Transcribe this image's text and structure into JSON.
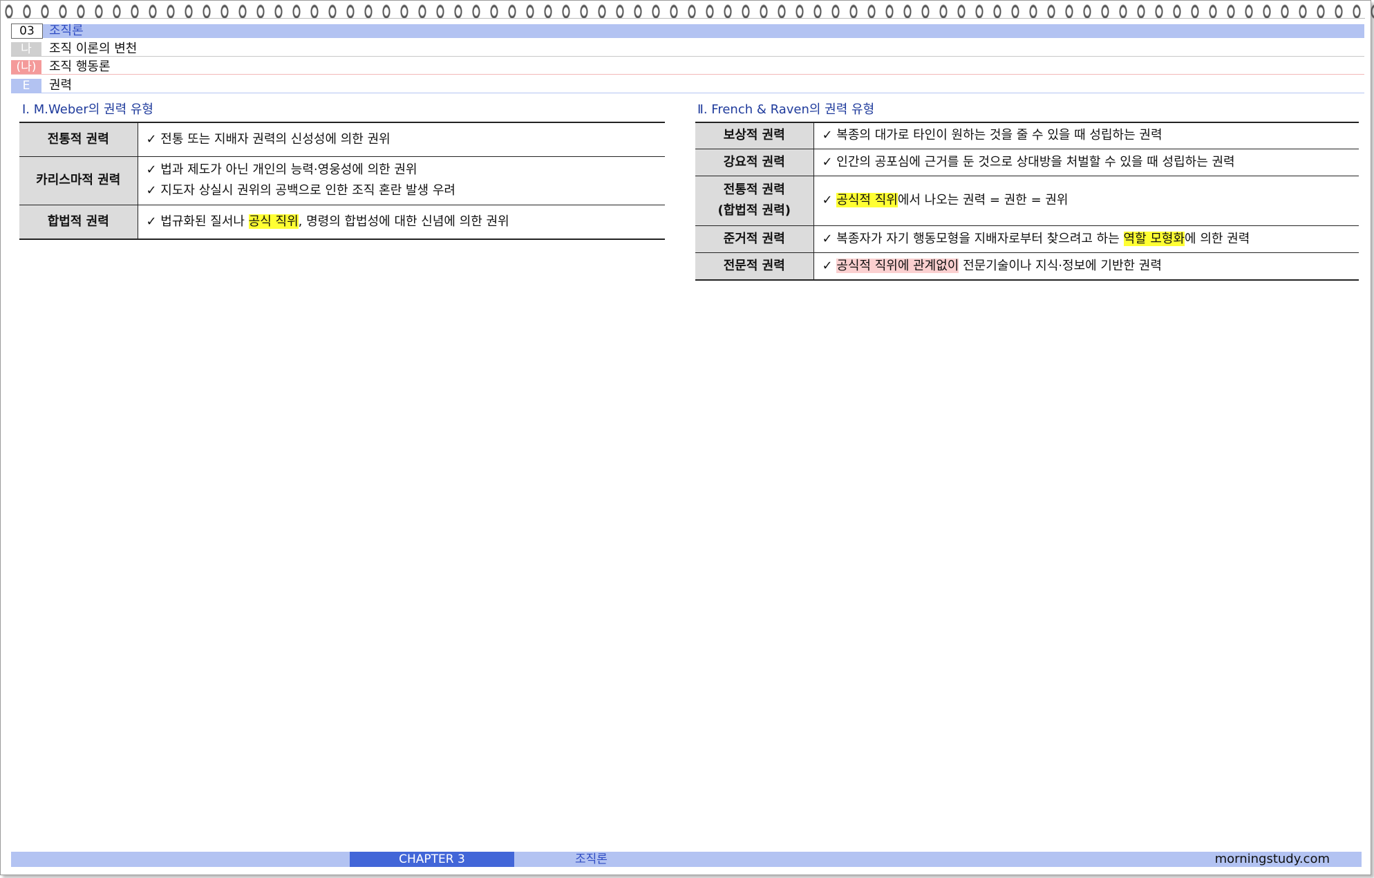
{
  "header": {
    "rows": [
      {
        "num": "03",
        "text": "조직론"
      },
      {
        "num": "나",
        "text": "조직 이론의 변천"
      },
      {
        "num": "(나)",
        "text": "조직 행동론"
      },
      {
        "num": "E",
        "text": "권력"
      }
    ]
  },
  "left": {
    "title": "Ⅰ. M.Weber의 권력 유형",
    "rows": [
      {
        "label": "전통적 권력",
        "lines": [
          "✓ 전통 또는 지배자 권력의 신성성에 의한 권위"
        ]
      },
      {
        "label": "카리스마적 권력",
        "lines": [
          "✓ 법과 제도가 아닌 개인의 능력·영웅성에 의한 권위",
          "✓ 지도자 상실시 권위의 공백으로 인한 조직 혼란 발생 우려"
        ]
      },
      {
        "label": "합법적 권력",
        "pre": "✓ 법규화된 질서나 ",
        "hl": "공식 직위",
        "post": ", 명령의 합법성에 대한 신념에 의한 권위"
      }
    ]
  },
  "right": {
    "title": "Ⅱ. French & Raven의 권력 유형",
    "rows": [
      {
        "label": "보상적 권력",
        "text": "✓ 복종의 대가로 타인이 원하는 것을 줄 수 있을 때 성립하는 권력"
      },
      {
        "label": "강요적 권력",
        "text": "✓ 인간의 공포심에 근거를 둔 것으로 상대방을 처벌할 수 있을 때 성립하는 권력"
      },
      {
        "label": "전통적 권력",
        "label2": "(합법적 권력)",
        "pre": "✓ ",
        "hl": "공식적 직위",
        "post": "에서 나오는 권력 = 권한 = 권위"
      },
      {
        "label": "준거적 권력",
        "pre": "✓ 복종자가 자기 행동모형을 지배자로부터 찾으려고 하는 ",
        "hl": "역할 모형화",
        "post": "에 의한 권력"
      },
      {
        "label": "전문적 권력",
        "pre": "✓ ",
        "hl": "공식적 직위에 관계없이",
        "post": " 전문기술이나 지식·정보에 기반한 권력"
      }
    ]
  },
  "footer": {
    "chapter": "CHAPTER 3",
    "title": "조직론",
    "site": "morningstudy.com"
  },
  "colors": {
    "header_blue": "#b3c3f2",
    "chapter_blue": "#4266d8",
    "highlight_yellow": "#ffff33",
    "highlight_pink": "#fbd0d0"
  }
}
